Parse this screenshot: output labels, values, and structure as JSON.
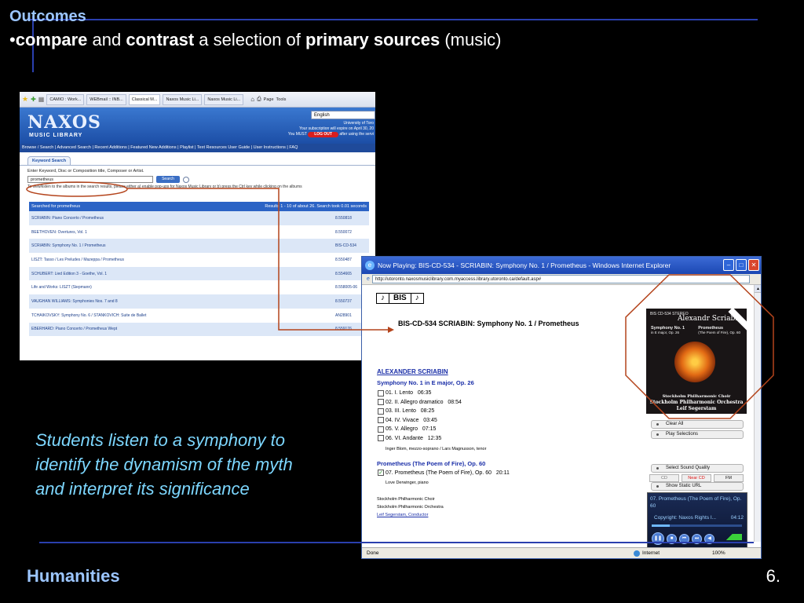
{
  "slide": {
    "title": "Outcomes",
    "bullet": {
      "prefix": "•",
      "w1": "compare",
      "w2": " and ",
      "w3": "contrast",
      "w4": " a selection of ",
      "w5": "primary sources",
      "w6": " (music)"
    },
    "caption": "Students listen to a symphony to identify the dynamism of the myth and interpret its significance",
    "footer_left": "Humanities",
    "footer_right": "6."
  },
  "naxos": {
    "tabs": [
      "CAMIO : Work...",
      "WEBmail :: INB...",
      "Classical M...",
      "Naxos Music Li...",
      "Naxos Music Li..."
    ],
    "toolbar_page": "Page",
    "toolbar_tools": "Tools",
    "logo": "NAXOS",
    "logo_sub": "MUSIC LIBRARY",
    "language": "English",
    "org": "University of Toro",
    "subscription": "Your subscription will expire on April 30, 20",
    "you_must": "You MUST",
    "logout": "LOG OUT",
    "after": "after using the servi",
    "nav": "Browse / Search  |  Advanced Search  |  Recent Additions  |  Featured New Additions  |  Playlist  |  Text Resources        User Guide  |  User Instructions  |  FAQ",
    "kw_tab": "Keyword Search",
    "kw_prompt": "Enter Keyword, Disc or Composition title, Composer or Artist.",
    "kw_value": "prometheus",
    "kw_button": "Search",
    "kw_note": "To view/listen to the albums in the search results, please either a) enable pop-ups for Naxos Music Library or b) press the Ctrl key while clicking on the albums",
    "results_left": "Searched for prometheus",
    "results_right": "Results 1 - 10 of about 26. Search took 0.01 seconds",
    "results": [
      {
        "title": "SCRIABIN: Piano Concerto / Prometheus",
        "code": "8.550818"
      },
      {
        "title": "BEETHOVEN: Overtures, Vol. 1",
        "code": "8.550072"
      },
      {
        "title": "SCRIABIN: Symphony No. 1 / Prometheus",
        "code": "BIS-CD-534"
      },
      {
        "title": "LISZT: Tasso / Les Preludes / Mazeppa / Prometheus",
        "code": "8.550487"
      },
      {
        "title": "SCHUBERT: Lied Edition 3 - Goethe, Vol. 1",
        "code": "8.554665"
      },
      {
        "title": "Life and Works: LISZT (Siepmann)",
        "code": "8.558005-06"
      },
      {
        "title": "VAUGHAN WILLIAMS: Symphonies Nos. 7 and 8",
        "code": "8.550737"
      },
      {
        "title": "TCHAIKOVSKY: Symphony No. 6 / STANKOVICH: Suite de Ballet",
        "code": "AN28901"
      },
      {
        "title": "EBERHARD: Piano Concerto / Prometheus Wept",
        "code": "8.559176"
      }
    ]
  },
  "player": {
    "window_title": "Now Playing: BIS-CD-534 - SCRIABIN: Symphony No. 1 / Prometheus - Windows Internet Explorer",
    "url": "http://utoronto.naxosmusiclibrary.com.myaccess.library.utoronto.ca/default.asp#",
    "label_logo": [
      "♪",
      "BIS",
      "♪"
    ],
    "album_title": "BIS-CD-534   SCRIABIN: Symphony No. 1 / Prometheus",
    "composer": "ALEXANDER SCRIABIN",
    "work1": "Symphony No. 1 in E major, Op. 26",
    "tracks": [
      {
        "label": "01. I. Lento",
        "time": "06:35"
      },
      {
        "label": "02. II. Allegro dramatico",
        "time": "08:54"
      },
      {
        "label": "03. III. Lento",
        "time": "08:25"
      },
      {
        "label": "04. IV. Vivace",
        "time": "03:45"
      },
      {
        "label": "05. V. Allegro",
        "time": "07:15"
      },
      {
        "label": "06. VI. Andante",
        "time": "12:35"
      }
    ],
    "performers1": "Inger Blom, mezzo-soprano / Lars Magnusson, tenor",
    "work2": "Prometheus (The Poem of Fire), Op. 60",
    "track7": {
      "label": "07. Prometheus (The Poem of Fire), Op. 60",
      "time": "20:11",
      "check": "✓"
    },
    "performers2": "Love Derwinger, piano",
    "ensemble1": "Stockholm Philharmonic Choir",
    "ensemble2": "Stockholm Philharmonic Orchestra",
    "conductor": "Leif Segerstam, Conductor",
    "cover": {
      "label": "BIS CD-534 STEREO",
      "name": "Alexandr Scriabin",
      "sym": "Symphony No. 1",
      "sym_sub": "in E major, Op. 26",
      "prom": "Prometheus",
      "prom_sub": "(The Poem of Fire), Op. 60",
      "orch1": "Stockholm Philharmonic Choir",
      "orch2": "Stockholm Philharmonic Orchestra",
      "orch3": "Leif Segerstam"
    },
    "btn_clear": "Clear All",
    "btn_play": "Play Selections",
    "quality_label": "Select Sound Quality",
    "q_cd": "CD",
    "q_near": "Near CD",
    "q_fm": "FM",
    "btn_static": "Show Static URL",
    "now_playing": "07. Prometheus (The Poem of Fire), Op. 60",
    "copyright": "Copyright: Naxos Rights I...",
    "elapsed": "04:12",
    "progress": 0.2,
    "status": "Done",
    "zone": "Internet",
    "zoom": "100%"
  }
}
